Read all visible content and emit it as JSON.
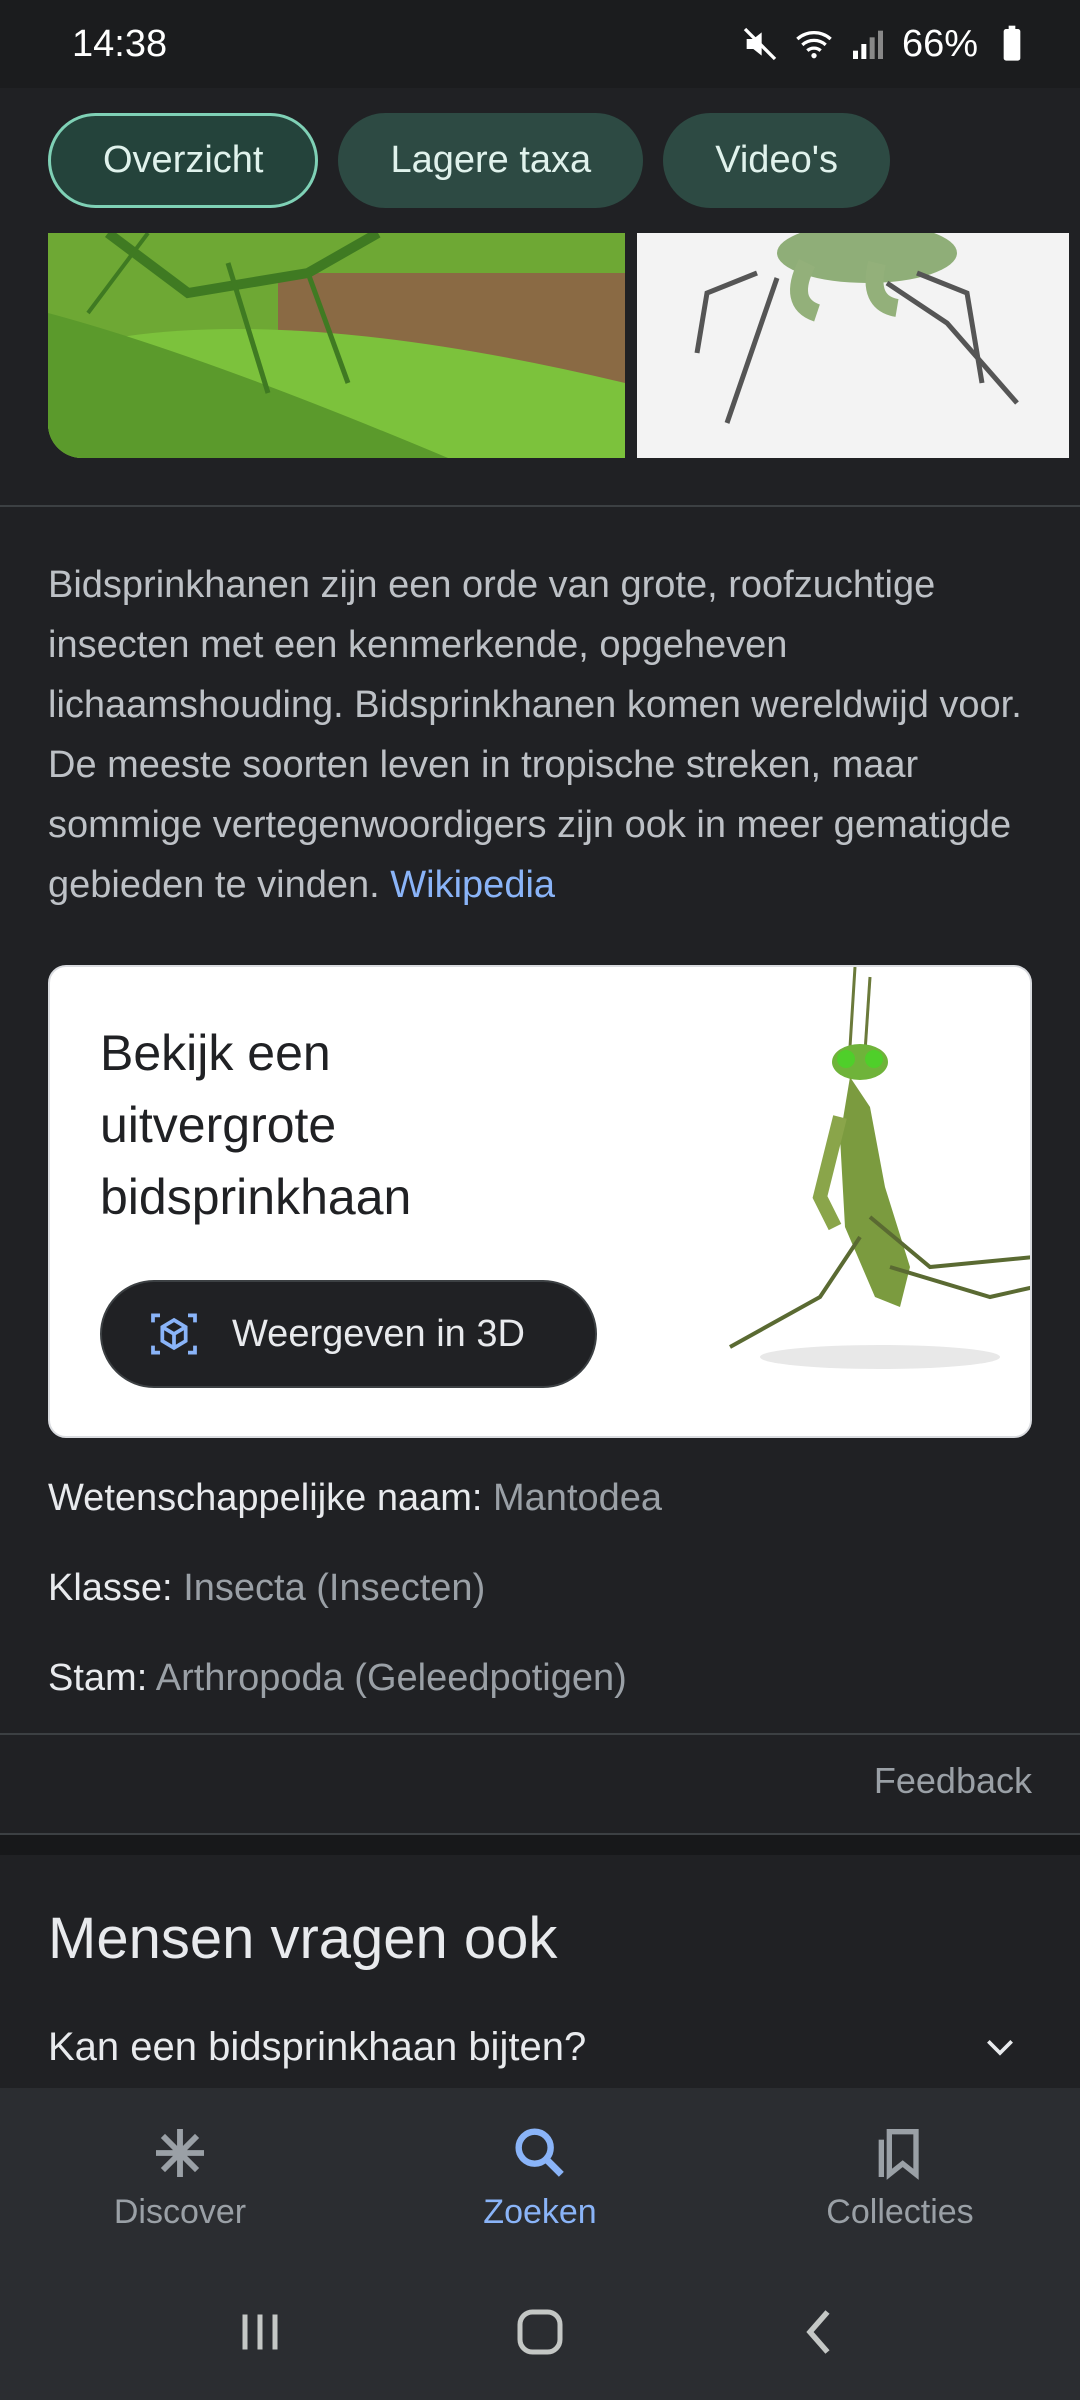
{
  "status_bar": {
    "time": "14:38",
    "battery": "66%"
  },
  "chips": [
    {
      "label": "Overzicht",
      "active": true
    },
    {
      "label": "Lagere taxa",
      "active": false
    },
    {
      "label": "Video's",
      "active": false
    }
  ],
  "description": {
    "text": "Bidsprinkhanen zijn een orde van grote, roofzuchtige insecten met een kenmerkende, opgeheven lichaamshouding. Bidsprinkhanen komen wereldwijd voor. De meeste soorten leven in tropische streken, maar sommige vertegenwoordigers zijn ook in meer gematigde gebieden te vinden.",
    "link": "Wikipedia"
  },
  "card3d": {
    "title": "Bekijk een uitvergrote bidsprinkhaan",
    "button": "Weergeven in 3D"
  },
  "facts": [
    {
      "label": "Wetenschappelijke naam:",
      "value": "Mantodea"
    },
    {
      "label": "Klasse:",
      "value": "Insecta (Insecten)"
    },
    {
      "label": "Stam:",
      "value": "Arthropoda (Geleedpotigen)"
    }
  ],
  "feedback": "Feedback",
  "people_also_ask": {
    "title": "Mensen vragen ook",
    "question": "Kan een bidsprinkhaan bijten?"
  },
  "bottom_nav": [
    {
      "label": "Discover",
      "icon": "asterisk-icon",
      "active": false
    },
    {
      "label": "Zoeken",
      "icon": "search-icon",
      "active": true
    },
    {
      "label": "Collecties",
      "icon": "bookmarks-icon",
      "active": false
    }
  ],
  "colors": {
    "accent": "#8ab4f8",
    "chip_bg": "#2d4a43",
    "chip_active_border": "#7fd1b6"
  }
}
